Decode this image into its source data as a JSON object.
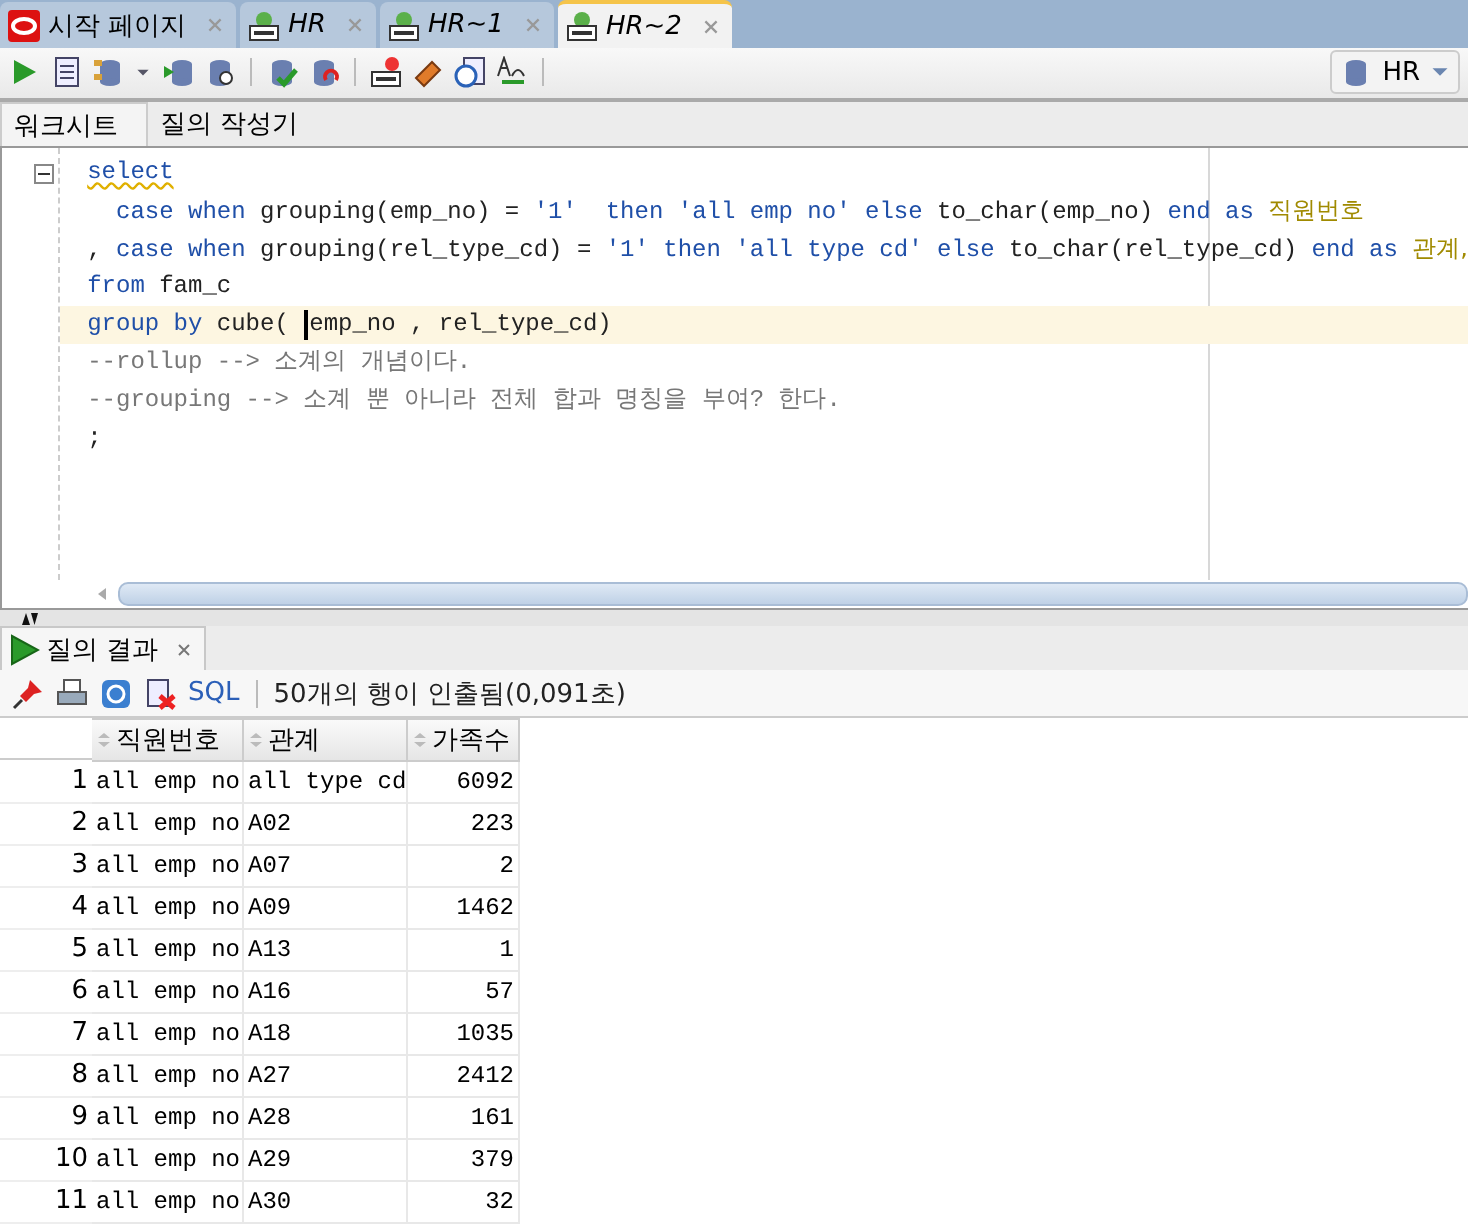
{
  "doc_tabs": [
    {
      "label": "시작 페이지",
      "kind": "start",
      "selected": false
    },
    {
      "label": "HR",
      "kind": "sql",
      "selected": false
    },
    {
      "label": "HR~1",
      "kind": "sql",
      "selected": false
    },
    {
      "label": "HR~2",
      "kind": "sql",
      "selected": true
    }
  ],
  "connection": {
    "label": "HR"
  },
  "sub_tabs": [
    {
      "label": "워크시트",
      "selected": true
    },
    {
      "label": "질의 작성기",
      "selected": false
    }
  ],
  "editor": {
    "fold_expanded": true,
    "lines": [
      {
        "current": false,
        "segments": [
          {
            "kind": "flagged",
            "text": "select"
          }
        ]
      },
      {
        "current": false,
        "segments": [
          {
            "kind": "keyword",
            "text": "  case when "
          },
          {
            "kind": "plain",
            "text": "grouping(emp_no) = "
          },
          {
            "kind": "string",
            "text": "'1'  "
          },
          {
            "kind": "keyword",
            "text": "then "
          },
          {
            "kind": "string",
            "text": "'all emp no' "
          },
          {
            "kind": "keyword",
            "text": "else "
          },
          {
            "kind": "plain",
            "text": "to_char(emp_no) "
          },
          {
            "kind": "keyword",
            "text": "end as "
          },
          {
            "kind": "alias",
            "text": "직원번호"
          }
        ]
      },
      {
        "current": false,
        "segments": [
          {
            "kind": "plain",
            "text": ", "
          },
          {
            "kind": "keyword",
            "text": "case when "
          },
          {
            "kind": "plain",
            "text": "grouping(rel_type_cd) = "
          },
          {
            "kind": "string",
            "text": "'1' "
          },
          {
            "kind": "keyword",
            "text": "then "
          },
          {
            "kind": "string",
            "text": "'all type cd' "
          },
          {
            "kind": "keyword",
            "text": "else "
          },
          {
            "kind": "plain",
            "text": "to_char(rel_type_cd) "
          },
          {
            "kind": "keyword",
            "text": "end as "
          },
          {
            "kind": "alias",
            "text": "관계,"
          }
        ]
      },
      {
        "current": false,
        "segments": [
          {
            "kind": "keyword",
            "text": "from "
          },
          {
            "kind": "plain",
            "text": "fam_c"
          }
        ]
      },
      {
        "current": true,
        "segments": [
          {
            "kind": "keyword",
            "text": "group by "
          },
          {
            "kind": "plain",
            "text": "cube( "
          },
          {
            "kind": "caret"
          },
          {
            "kind": "plain",
            "text": "emp_no , rel_type_cd)"
          }
        ]
      },
      {
        "current": false,
        "segments": [
          {
            "kind": "comment",
            "text": "--rollup --> 소계의 개념이다."
          }
        ]
      },
      {
        "current": false,
        "segments": [
          {
            "kind": "comment",
            "text": "--grouping --> 소계 뿐 아니라 전체 합과 명칭을 부여? 한다."
          }
        ]
      },
      {
        "current": false,
        "segments": [
          {
            "kind": "plain",
            "text": ";"
          }
        ]
      }
    ]
  },
  "results": {
    "tab": {
      "label": "질의 결과",
      "selected": true
    },
    "sql_link": "SQL",
    "status": "50개의 행이 인출됨(0,091초)",
    "columns": [
      "직원번호",
      "관계",
      "가족수"
    ],
    "rows": [
      {
        "number": "1",
        "cells": [
          "all emp no",
          "all type cd",
          "6092"
        ]
      },
      {
        "number": "2",
        "cells": [
          "all emp no",
          "A02",
          "223"
        ]
      },
      {
        "number": "3",
        "cells": [
          "all emp no",
          "A07",
          "2"
        ]
      },
      {
        "number": "4",
        "cells": [
          "all emp no",
          "A09",
          "1462"
        ]
      },
      {
        "number": "5",
        "cells": [
          "all emp no",
          "A13",
          "1"
        ]
      },
      {
        "number": "6",
        "cells": [
          "all emp no",
          "A16",
          "57"
        ]
      },
      {
        "number": "7",
        "cells": [
          "all emp no",
          "A18",
          "1035"
        ]
      },
      {
        "number": "8",
        "cells": [
          "all emp no",
          "A27",
          "2412"
        ]
      },
      {
        "number": "9",
        "cells": [
          "all emp no",
          "A28",
          "161"
        ]
      },
      {
        "number": "10",
        "cells": [
          "all emp no",
          "A29",
          "379"
        ]
      },
      {
        "number": "11",
        "cells": [
          "all emp no",
          "A30",
          "32"
        ]
      }
    ]
  }
}
